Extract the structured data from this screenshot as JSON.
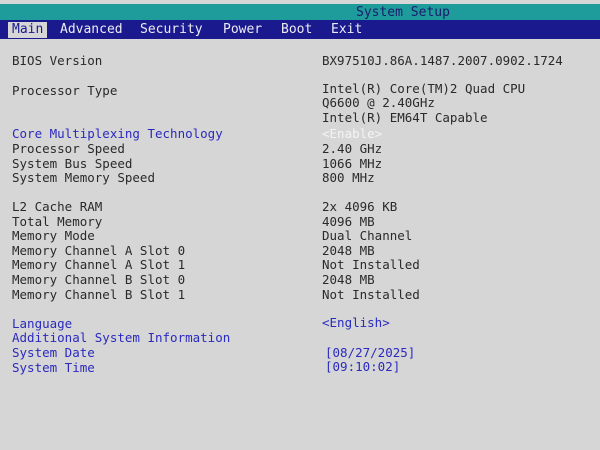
{
  "window": {
    "title": "System Setup"
  },
  "menu": {
    "items": [
      "Main",
      "Advanced",
      "Security",
      "Power",
      "Boot",
      "Exit"
    ],
    "active": "Main"
  },
  "main": {
    "bios_version_label": "BIOS Version",
    "bios_version_value": "BX97510J.86A.1487.2007.0902.1724",
    "processor_type_label": "Processor Type",
    "processor_type_line1": "Intel(R) Core(TM)2 Quad CPU",
    "processor_type_line2": "Q6600  @ 2.40GHz",
    "processor_type_line3": "Intel(R) EM64T Capable",
    "core_multiplexing_label": "Core Multiplexing Technology",
    "core_multiplexing_value": "<Enable>",
    "processor_speed_label": "Processor Speed",
    "processor_speed_value": "2.40 GHz",
    "system_bus_speed_label": "System Bus Speed",
    "system_bus_speed_value": "1066 MHz",
    "system_memory_speed_label": "System Memory Speed",
    "system_memory_speed_value": "800 MHz",
    "l2_cache_label": "L2 Cache RAM",
    "l2_cache_value": "2x 4096 KB",
    "total_memory_label": "Total Memory",
    "total_memory_value": "4096 MB",
    "memory_mode_label": "Memory Mode",
    "memory_mode_value": "Dual Channel",
    "mem_a0_label": "Memory Channel A Slot 0",
    "mem_a0_value": "2048 MB",
    "mem_a1_label": "Memory Channel A Slot 1",
    "mem_a1_value": "Not Installed",
    "mem_b0_label": "Memory Channel B Slot 0",
    "mem_b0_value": "2048 MB",
    "mem_b1_label": "Memory Channel B Slot 1",
    "mem_b1_value": "Not Installed",
    "language_label": "Language",
    "language_value": "<English>",
    "additional_info_label": "Additional System Information",
    "system_date_label": "System Date",
    "system_date_value": "[08/27/2025]",
    "system_time_label": "System Time",
    "system_time_value": "[09:10:02]"
  },
  "colors": {
    "title_bar": "#1e9b9b",
    "menu_bar": "#1a1a8e",
    "background": "#d6d6d6",
    "selectable_text": "#2a2abf",
    "static_text": "#2a2a2a"
  }
}
